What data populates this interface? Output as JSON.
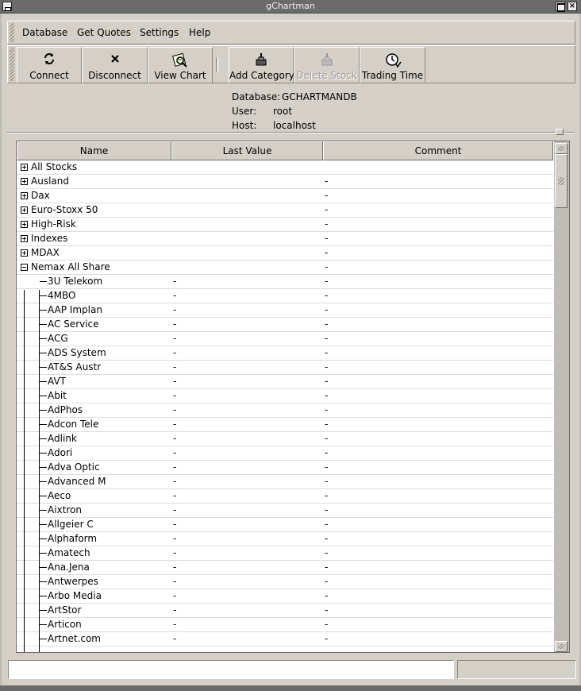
{
  "window": {
    "title": "gChartman"
  },
  "menu": [
    "Database",
    "Get Quotes",
    "Settings",
    "Help"
  ],
  "toolbar": [
    {
      "label": "Connect",
      "icon": "connect-icon",
      "enabled": true
    },
    {
      "label": "Disconnect",
      "icon": "disconnect-icon",
      "enabled": true
    },
    {
      "label": "View Chart",
      "icon": "view-chart-icon",
      "enabled": true
    },
    {
      "label": "Add Category",
      "icon": "add-category-icon",
      "enabled": true
    },
    {
      "label": "Delete Stock",
      "icon": "delete-stock-icon",
      "enabled": false
    },
    {
      "label": "Trading Time",
      "icon": "clock-icon",
      "enabled": true
    }
  ],
  "info": {
    "database_label": "Database:",
    "database_value": "GCHARTMANDB",
    "user_label": "User:",
    "user_value": "root",
    "host_label": "Host:",
    "host_value": "localhost"
  },
  "tree": {
    "columns": [
      "Name",
      "Last Value",
      "Comment"
    ],
    "categories": [
      {
        "name": "All Stocks",
        "comment": "",
        "expanded": false
      },
      {
        "name": "Ausland",
        "comment": "-",
        "expanded": false
      },
      {
        "name": "Dax",
        "comment": "-",
        "expanded": false
      },
      {
        "name": "Euro-Stoxx 50",
        "comment": "-",
        "expanded": false
      },
      {
        "name": "High-Risk",
        "comment": "-",
        "expanded": false
      },
      {
        "name": "Indexes",
        "comment": "-",
        "expanded": false
      },
      {
        "name": "MDAX",
        "comment": "-",
        "expanded": false
      },
      {
        "name": "Nemax All Share",
        "comment": "-",
        "expanded": true
      }
    ],
    "stocks": [
      {
        "name": "3U Telekom",
        "last_value": "-",
        "comment": "-"
      },
      {
        "name": "4MBO",
        "last_value": "-",
        "comment": "-"
      },
      {
        "name": "AAP Implan",
        "last_value": "-",
        "comment": "-"
      },
      {
        "name": "AC Service",
        "last_value": "-",
        "comment": "-"
      },
      {
        "name": "ACG",
        "last_value": "-",
        "comment": "-"
      },
      {
        "name": "ADS System",
        "last_value": "-",
        "comment": "-"
      },
      {
        "name": "AT&S Austr",
        "last_value": "-",
        "comment": "-"
      },
      {
        "name": "AVT",
        "last_value": "-",
        "comment": "-"
      },
      {
        "name": "Abit",
        "last_value": "-",
        "comment": "-"
      },
      {
        "name": "AdPhos",
        "last_value": "-",
        "comment": "-"
      },
      {
        "name": "Adcon Tele",
        "last_value": "-",
        "comment": "-"
      },
      {
        "name": "Adlink",
        "last_value": "-",
        "comment": "-"
      },
      {
        "name": "Adori",
        "last_value": "-",
        "comment": "-"
      },
      {
        "name": "Adva Optic",
        "last_value": "-",
        "comment": "-"
      },
      {
        "name": "Advanced M",
        "last_value": "-",
        "comment": "-"
      },
      {
        "name": "Aeco",
        "last_value": "-",
        "comment": "-"
      },
      {
        "name": "Aixtron",
        "last_value": "-",
        "comment": "-"
      },
      {
        "name": "Allgeier C",
        "last_value": "-",
        "comment": "-"
      },
      {
        "name": "Alphaform",
        "last_value": "-",
        "comment": "-"
      },
      {
        "name": "Amatech",
        "last_value": "-",
        "comment": "-"
      },
      {
        "name": "Ana.Jena",
        "last_value": "-",
        "comment": "-"
      },
      {
        "name": "Antwerpes",
        "last_value": "-",
        "comment": "-"
      },
      {
        "name": "Arbo Media",
        "last_value": "-",
        "comment": "-"
      },
      {
        "name": "ArtStor",
        "last_value": "-",
        "comment": "-"
      },
      {
        "name": "Articon",
        "last_value": "-",
        "comment": "-"
      },
      {
        "name": "Artnet.com",
        "last_value": "-",
        "comment": "-"
      }
    ]
  },
  "status": {
    "message": ""
  }
}
